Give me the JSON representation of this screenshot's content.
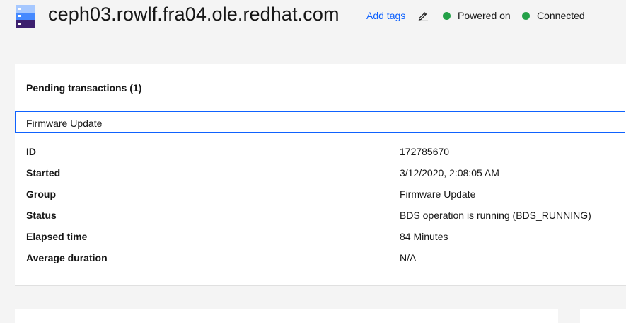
{
  "header": {
    "title": "ceph03.rowlf.fra04.ole.redhat.com",
    "add_tags_label": "Add tags",
    "edit_icon": "pencil-icon",
    "server_icon": "server-icon",
    "statuses": [
      {
        "label": "Powered on",
        "color": "#24a148"
      },
      {
        "label": "Connected",
        "color": "#24a148"
      }
    ]
  },
  "pending": {
    "title": "Pending transactions (1)",
    "selected_transaction": "Firmware Update",
    "details": [
      {
        "label": "ID",
        "value": "172785670"
      },
      {
        "label": "Started",
        "value": "3/12/2020, 2:08:05 AM"
      },
      {
        "label": "Group",
        "value": "Firmware Update"
      },
      {
        "label": "Status",
        "value": "BDS operation is running (BDS_RUNNING)"
      },
      {
        "label": "Elapsed time",
        "value": "84 Minutes"
      },
      {
        "label": "Average duration",
        "value": "N/A"
      }
    ]
  },
  "colors": {
    "accent": "#0f62fe",
    "status_ok": "#24a148"
  }
}
